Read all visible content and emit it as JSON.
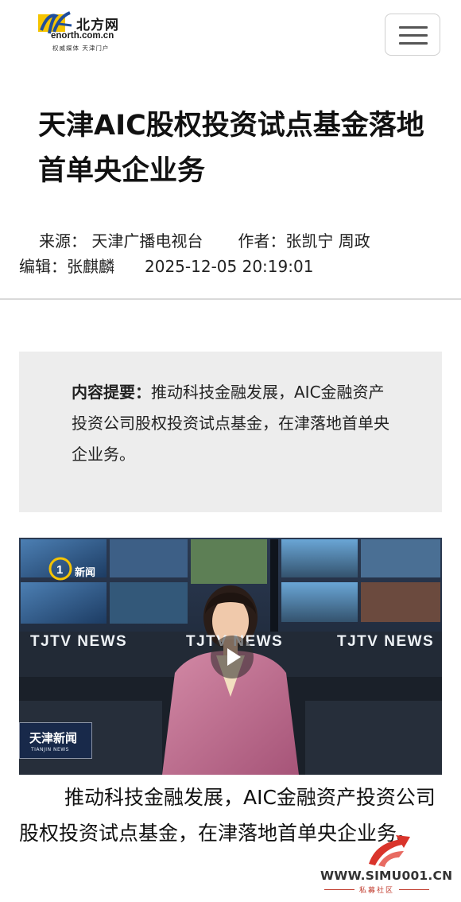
{
  "header": {
    "logo_cn": "北方网",
    "logo_domain": "enorth.com.cn",
    "logo_tagline": "权威媒体 天津门户",
    "menu_icon": "hamburger-menu-icon"
  },
  "article": {
    "title": "天津AIC股权投资试点基金落地首单央企业务",
    "source_label": "来源：",
    "source_value": "天津广播电视台",
    "author_label": "作者：",
    "author_value": "张凯宁 周政",
    "editor_label": "编辑：",
    "editor_value": "张麒麟",
    "datetime": "2025-12-05 20:19:01",
    "summary_label": "内容提要：",
    "summary_text": "推动科技金融发展，AIC金融资产投资公司股权投资试点基金，在津落地首单央企业务。",
    "body_paragraph": "推动科技金融发展，AIC金融资产投资公司股权投资试点基金，在津落地首单央企业务。"
  },
  "video": {
    "channel_logo_text": "新闻",
    "channel_number": "1",
    "banner_text": "TJTV NEWS",
    "program_badge": "天津新闻",
    "program_badge_en": "TIANJIN NEWS",
    "play_icon": "play-icon"
  },
  "watermark": {
    "url": "WWW.SIMU001.CN",
    "subtitle": "私募社区"
  },
  "colors": {
    "accent_yellow": "#f5c400",
    "logo_blue": "#1f4e9c",
    "summary_bg": "#ededed",
    "watermark_red": "#d9342b"
  }
}
